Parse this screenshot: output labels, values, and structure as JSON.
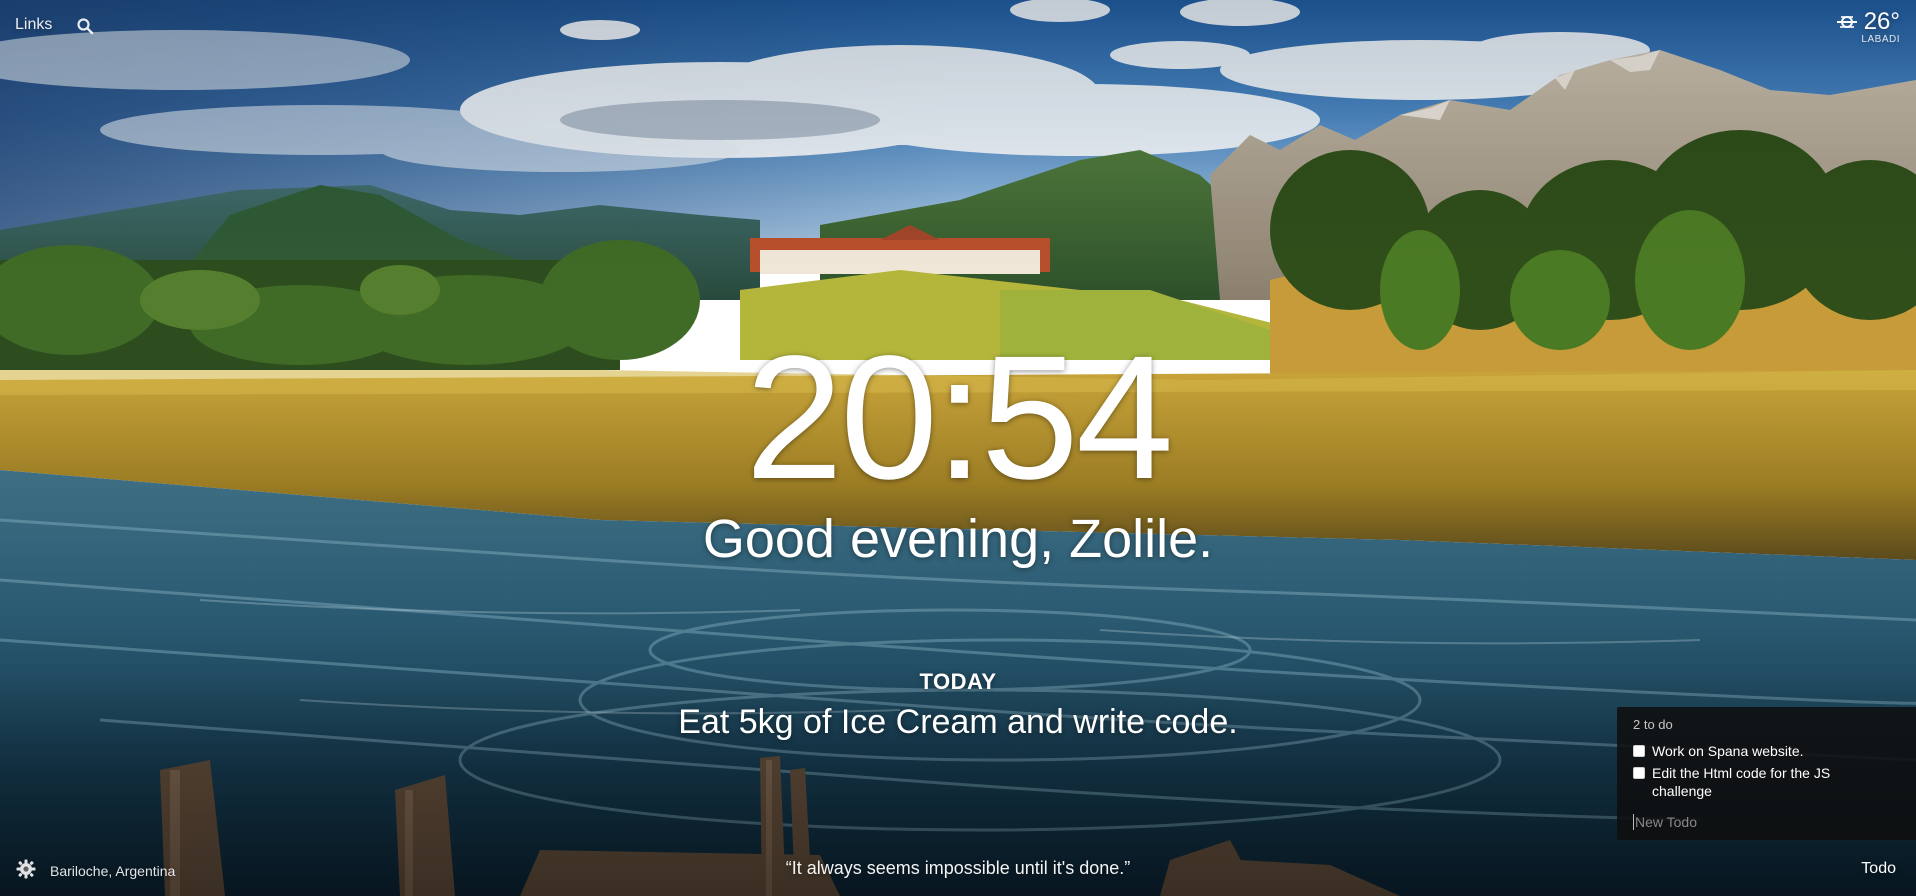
{
  "topbar": {
    "links_label": "Links"
  },
  "weather": {
    "temperature": "26°",
    "location": "LABADI"
  },
  "clock": {
    "time": "20:54"
  },
  "greeting": "Good evening, Zolile.",
  "focus": {
    "label": "TODAY",
    "text": "Eat 5kg of Ice Cream and write code."
  },
  "photo": {
    "location": "Bariloche, Argentina"
  },
  "quote": "“It always seems impossible until it's done.”",
  "todo": {
    "count_label": "2 to do",
    "items": [
      {
        "text": "Work on Spana website.",
        "done": false
      },
      {
        "text": "Edit the Html code for the JS challenge",
        "done": false
      }
    ],
    "new_placeholder": "New Todo",
    "toggle_label": "Todo"
  },
  "icons": {
    "search": "search-icon",
    "weather": "weather-haze-icon",
    "settings": "gear-icon"
  }
}
